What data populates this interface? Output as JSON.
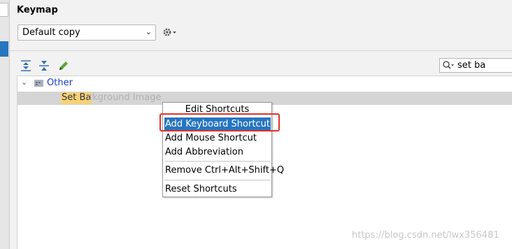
{
  "header": {
    "title": "Keymap"
  },
  "keymap_select": {
    "value": "Default copy"
  },
  "search": {
    "value": "set ba"
  },
  "tree": {
    "group_label": "Other",
    "selected_row": {
      "highlight": "Set Ba",
      "rest": "ckground Image"
    }
  },
  "context_menu": {
    "header": "Edit Shortcuts",
    "items": [
      "Add Keyboard Shortcut",
      "Add Mouse Shortcut",
      "Add Abbreviation",
      "Remove Ctrl+Alt+Shift+Q",
      "Reset Shortcuts"
    ]
  },
  "watermark": "https://blog.csdn.net/lwx356481",
  "colors": {
    "accent": "#2675bf",
    "annotation": "#e0322b",
    "search_highlight": "#f5d27a",
    "link": "#1a3cc8"
  }
}
